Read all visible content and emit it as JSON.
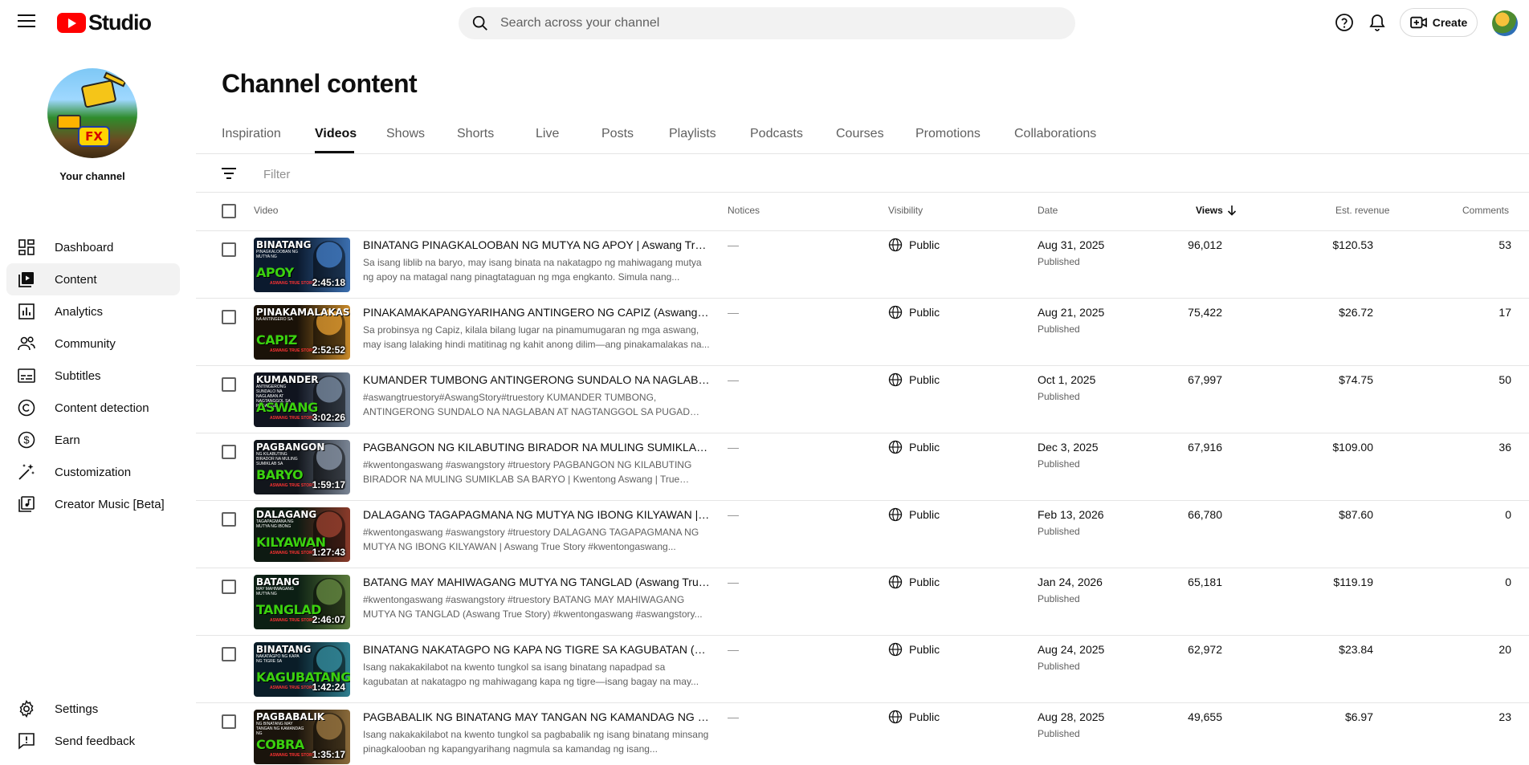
{
  "app": {
    "logo_text": "Studio"
  },
  "header": {
    "search_placeholder": "Search across your channel",
    "create_label": "Create"
  },
  "sidebar": {
    "channel_label": "Your channel",
    "items": [
      {
        "label": "Dashboard",
        "icon": "dashboard-icon"
      },
      {
        "label": "Content",
        "icon": "content-icon",
        "active": true
      },
      {
        "label": "Analytics",
        "icon": "analytics-icon"
      },
      {
        "label": "Community",
        "icon": "community-icon"
      },
      {
        "label": "Subtitles",
        "icon": "subtitles-icon"
      },
      {
        "label": "Content detection",
        "icon": "copyright-icon"
      },
      {
        "label": "Earn",
        "icon": "earn-icon"
      },
      {
        "label": "Customization",
        "icon": "customization-icon"
      },
      {
        "label": "Creator Music [Beta]",
        "icon": "music-icon"
      }
    ],
    "bottom": [
      {
        "label": "Settings",
        "icon": "gear-icon"
      },
      {
        "label": "Send feedback",
        "icon": "feedback-icon"
      }
    ]
  },
  "main": {
    "title": "Channel content",
    "tabs": [
      "Inspiration",
      "Videos",
      "Shows",
      "Shorts",
      "Live",
      "Posts",
      "Playlists",
      "Podcasts",
      "Courses",
      "Promotions",
      "Collaborations"
    ],
    "active_tab": "Videos",
    "filter_placeholder": "Filter",
    "columns": {
      "video": "Video",
      "notices": "Notices",
      "visibility": "Visibility",
      "date": "Date",
      "views": "Views",
      "revenue": "Est. revenue",
      "comments": "Comments"
    }
  },
  "videos": [
    {
      "title": "BINATANG PINAGKALOOBAN NG MUTYA NG APOY | Aswang True Story",
      "desc": "Sa isang liblib na baryo, may isang binata na nakatagpo ng mahiwagang mutya ng apoy na matagal nang pinagtataguan ng mga engkanto. Simula nang...",
      "duration": "2:45:18",
      "notice": "—",
      "visibility": "Public",
      "date": "Aug 31, 2025",
      "status": "Published",
      "views": "96,012",
      "revenue": "$120.53",
      "comments": "53",
      "thumb": {
        "top": "BINATANG",
        "mid": "PINAGKALOOBAN NG MUTYA NG",
        "big": "APOY",
        "tag": "ASWANG TRUE STORY",
        "color": "#3bd10f",
        "bg": "#0b1a2e",
        "fig": "#3b6fb0"
      }
    },
    {
      "title": "PINAKAMAKAPANGYARIHANG ANTINGERO NG CAPIZ (Aswang True Story)",
      "desc": "Sa probinsya ng Capiz, kilala bilang lugar na pinamumugaran ng mga aswang, may isang lalaking hindi matitinag ng kahit anong dilim—ang pinakamalakas na...",
      "duration": "2:52:52",
      "notice": "—",
      "visibility": "Public",
      "date": "Aug 21, 2025",
      "status": "Published",
      "views": "75,422",
      "revenue": "$26.72",
      "comments": "17",
      "thumb": {
        "top": "PINAKAMALAKAS",
        "mid": "NA ANTINGERO SA",
        "big": "CAPIZ",
        "tag": "ASWANG TRUE STORY",
        "color": "#3bd10f",
        "bg": "#1a1208",
        "fig": "#c98a2a"
      }
    },
    {
      "title": "KUMANDER TUMBONG ANTINGERONG SUNDALO NA NAGLABAN AT NAGTANGGOL",
      "desc": "#aswangtruestory#AswangStory#truestory KUMANDER TUMBONG, ANTINGERONG SUNDALO NA NAGLABAN AT NAGTANGGOL SA PUGAD NG...",
      "duration": "3:02:26",
      "notice": "—",
      "visibility": "Public",
      "date": "Oct 1, 2025",
      "status": "Published",
      "views": "67,997",
      "revenue": "$74.75",
      "comments": "50",
      "thumb": {
        "top": "KUMANDER",
        "mid": "ANTINGERONG SUNDALO NA NAGLABAN AT NAGTANGGOL SA PUGAD NG",
        "big": "ASWANG",
        "tag": "ASWANG TRUE STORY",
        "color": "#3bd10f",
        "bg": "#10141f",
        "fig": "#6b7b8f"
      }
    },
    {
      "title": "PAGBANGON NG KILABUTING BIRADOR NA MULING SUMIKLAB SA BARYO",
      "desc": "#kwentongaswang #aswangstory #truestory PAGBANGON NG KILABUTING BIRADOR NA MULING SUMIKLAB SA BARYO | Kwentong Aswang | True Story...",
      "duration": "1:59:17",
      "notice": "—",
      "visibility": "Public",
      "date": "Dec 3, 2025",
      "status": "Published",
      "views": "67,916",
      "revenue": "$109.00",
      "comments": "36",
      "thumb": {
        "top": "PAGBANGON",
        "mid": "NG KILABUTING BIRADOR NA MULING SUMIKLAB SA",
        "big": "BARYO",
        "tag": "ASWANG TRUE STORY",
        "color": "#3bd10f",
        "bg": "#12161c",
        "fig": "#7a8595"
      }
    },
    {
      "title": "DALAGANG TAGAPAGMANA NG MUTYA NG IBONG KILYAWAN | Aswang True Story",
      "desc": "#kwentongaswang #aswangstory #truestory DALAGANG TAGAPAGMANA NG MUTYA NG IBONG KILYAWAN | Aswang True Story #kwentongaswang...",
      "duration": "1:27:43",
      "notice": "—",
      "visibility": "Public",
      "date": "Feb 13, 2026",
      "status": "Published",
      "views": "66,780",
      "revenue": "$87.60",
      "comments": "0",
      "thumb": {
        "top": "DALAGANG",
        "mid": "TAGAPAGMANA NG MUTYA NG IBONG",
        "big": "KILYAWAN",
        "tag": "ASWANG TRUE STORY",
        "color": "#3bd10f",
        "bg": "#0e1a12",
        "fig": "#8a3a2a"
      }
    },
    {
      "title": "BATANG MAY MAHIWAGANG MUTYA NG TANGLAD (Aswang True Story)",
      "desc": "#kwentongaswang #aswangstory #truestory BATANG MAY MAHIWAGANG MUTYA NG TANGLAD (Aswang True Story) #kwentongaswang #aswangstory...",
      "duration": "2:46:07",
      "notice": "—",
      "visibility": "Public",
      "date": "Jan 24, 2026",
      "status": "Published",
      "views": "65,181",
      "revenue": "$119.19",
      "comments": "0",
      "thumb": {
        "top": "BATANG",
        "mid": "MAY MAHIWAGANG MUTYA NG",
        "big": "TANGLAD",
        "tag": "ASWANG TRUE STORY",
        "color": "#3bd10f",
        "bg": "#0c1f14",
        "fig": "#5a7a3a"
      }
    },
    {
      "title": "BINATANG NAKATAGPO NG KAPA NG TIGRE SA KAGUBATAN (Aswang True Story)",
      "desc": "Isang nakakakilabot na kwento tungkol sa isang binatang napadpad sa kagubatan at nakatagpo ng mahiwagang kapa ng tigre—isang bagay na may...",
      "duration": "1:42:24",
      "notice": "—",
      "visibility": "Public",
      "date": "Aug 24, 2025",
      "status": "Published",
      "views": "62,972",
      "revenue": "$23.84",
      "comments": "20",
      "thumb": {
        "top": "BINATANG",
        "mid": "NAKATAGPO NG KAPA NG TIGRE SA",
        "big": "KAGUBATANG",
        "tag": "ASWANG TRUE STORY",
        "color": "#3bd10f",
        "bg": "#0a1d28",
        "fig": "#2f7f8f"
      }
    },
    {
      "title": "PAGBABALIK NG BINATANG MAY TANGAN NG KAMANDAG NG COBRA",
      "desc": "Isang nakakakilabot na kwento tungkol sa pagbabalik ng isang binatang minsang pinagkalooban ng kapangyarihang nagmula sa kamandag ng isang...",
      "duration": "1:35:17",
      "notice": "—",
      "visibility": "Public",
      "date": "Aug 28, 2025",
      "status": "Published",
      "views": "49,655",
      "revenue": "$6.97",
      "comments": "23",
      "thumb": {
        "top": "PAGBABALIK",
        "mid": "NG BINATANG MAY TANGAN NG KAMANDAG NG",
        "big": "COBRA",
        "tag": "ASWANG TRUE STORY",
        "color": "#3bd10f",
        "bg": "#1a140c",
        "fig": "#8a6a3a"
      }
    }
  ]
}
